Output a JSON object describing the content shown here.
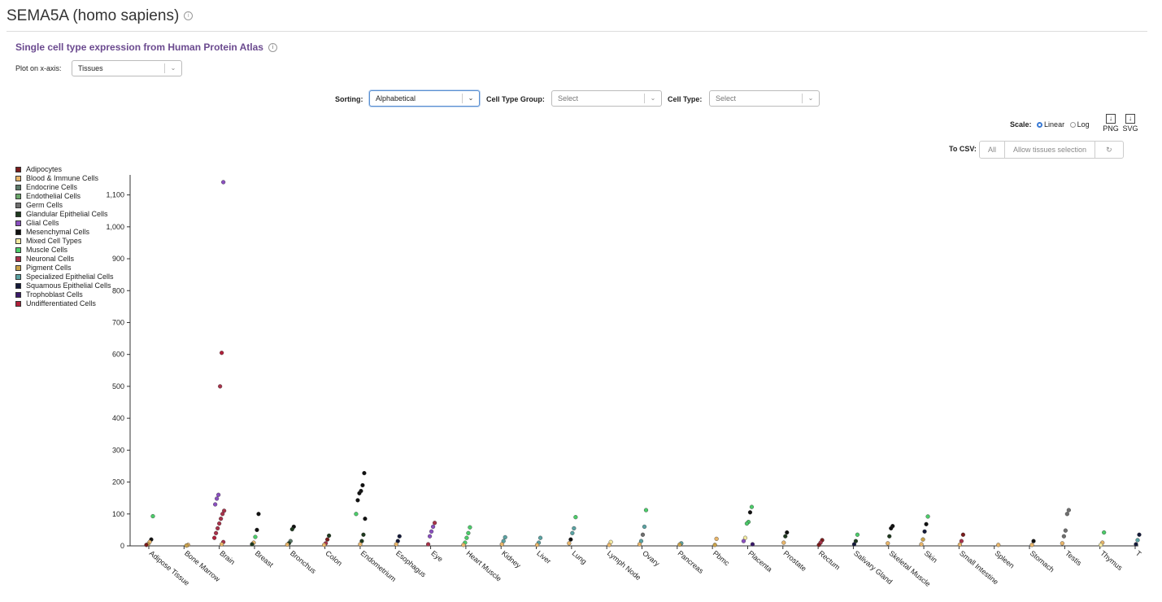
{
  "page": {
    "title": "SEMA5A (homo sapiens)",
    "section_title": "Single cell type expression from Human Protein Atlas"
  },
  "controls": {
    "xaxis_label": "Plot on x-axis:",
    "xaxis_value": "Tissues",
    "sorting_label": "Sorting:",
    "sorting_value": "Alphabetical",
    "cell_type_group_label": "Cell Type Group:",
    "cell_type_group_placeholder": "Select",
    "cell_type_label": "Cell Type:",
    "cell_type_placeholder": "Select",
    "scale_label": "Scale:",
    "scale_linear": "Linear",
    "scale_log": "Log",
    "scale_selected": "Linear",
    "png_label": "PNG",
    "svg_label": "SVG",
    "csv_label": "To CSV:",
    "csv_all": "All",
    "csv_allow": "Allow tissues selection",
    "refresh_icon": "refresh-icon"
  },
  "chart_data": {
    "type": "scatter",
    "title": "",
    "xlabel": "",
    "ylabel": "",
    "ylim": [
      0,
      1150
    ],
    "yticks": [
      0,
      100,
      200,
      300,
      400,
      500,
      600,
      700,
      800,
      900,
      1000,
      1100
    ],
    "ytick_labels": [
      "0",
      "100",
      "200",
      "300",
      "400",
      "500",
      "600",
      "700",
      "800",
      "900",
      "1,000",
      "1,100"
    ],
    "legend_position": "left",
    "categories": [
      "Adipose Tissue",
      "Bone Marrow",
      "Brain",
      "Breast",
      "Bronchus",
      "Colon",
      "Endometrium",
      "Esophagus",
      "Eye",
      "Heart Muscle",
      "Kidney",
      "Liver",
      "Lung",
      "Lymph Node",
      "Ovary",
      "Pancreas",
      "Pbmc",
      "Placenta",
      "Prostate",
      "Rectum",
      "Salivary Gland",
      "Skeletal Muscle",
      "Skin",
      "Small Intestine",
      "Spleen",
      "Stomach",
      "Testis",
      "Thymus",
      "T"
    ],
    "legend": [
      {
        "name": "Adipocytes",
        "color": "#7a1c1c"
      },
      {
        "name": "Blood & Immune Cells",
        "color": "#e8b56a"
      },
      {
        "name": "Endocrine Cells",
        "color": "#5c7a6a"
      },
      {
        "name": "Endothelial Cells",
        "color": "#6aa86a"
      },
      {
        "name": "Germ Cells",
        "color": "#6f6f6f"
      },
      {
        "name": "Glandular Epithelial Cells",
        "color": "#1f3a1f"
      },
      {
        "name": "Glial Cells",
        "color": "#8a4fbf"
      },
      {
        "name": "Mesenchymal Cells",
        "color": "#111111"
      },
      {
        "name": "Mixed Cell Types",
        "color": "#f3e9a0"
      },
      {
        "name": "Muscle Cells",
        "color": "#4ccc6a"
      },
      {
        "name": "Neuronal Cells",
        "color": "#a8324a"
      },
      {
        "name": "Pigment Cells",
        "color": "#c9a24a"
      },
      {
        "name": "Specialized Epithelial Cells",
        "color": "#5aa3a3"
      },
      {
        "name": "Squamous Epithelial Cells",
        "color": "#141a3a"
      },
      {
        "name": "Trophoblast Cells",
        "color": "#3a1a6a"
      },
      {
        "name": "Undifferentiated Cells",
        "color": "#b0203a"
      }
    ],
    "points": [
      {
        "x": "Adipose Tissue",
        "y": 93,
        "group": "Muscle Cells"
      },
      {
        "x": "Adipose Tissue",
        "y": 20,
        "group": "Mesenchymal Cells"
      },
      {
        "x": "Adipose Tissue",
        "y": 12,
        "group": "Blood & Immune Cells"
      },
      {
        "x": "Adipose Tissue",
        "y": 5,
        "group": "Pigment Cells"
      },
      {
        "x": "Adipose Tissue",
        "y": 3,
        "group": "Adipocytes"
      },
      {
        "x": "Bone Marrow",
        "y": 3,
        "group": "Blood & Immune Cells"
      },
      {
        "x": "Bone Marrow",
        "y": 1,
        "group": "Pigment Cells"
      },
      {
        "x": "Brain",
        "y": 1140,
        "group": "Glial Cells"
      },
      {
        "x": "Brain",
        "y": 605,
        "group": "Undifferentiated Cells"
      },
      {
        "x": "Brain",
        "y": 500,
        "group": "Neuronal Cells"
      },
      {
        "x": "Brain",
        "y": 160,
        "group": "Glial Cells"
      },
      {
        "x": "Brain",
        "y": 148,
        "group": "Glial Cells"
      },
      {
        "x": "Brain",
        "y": 130,
        "group": "Glial Cells"
      },
      {
        "x": "Brain",
        "y": 110,
        "group": "Neuronal Cells"
      },
      {
        "x": "Brain",
        "y": 100,
        "group": "Neuronal Cells"
      },
      {
        "x": "Brain",
        "y": 85,
        "group": "Neuronal Cells"
      },
      {
        "x": "Brain",
        "y": 70,
        "group": "Neuronal Cells"
      },
      {
        "x": "Brain",
        "y": 55,
        "group": "Neuronal Cells"
      },
      {
        "x": "Brain",
        "y": 40,
        "group": "Neuronal Cells"
      },
      {
        "x": "Brain",
        "y": 25,
        "group": "Undifferentiated Cells"
      },
      {
        "x": "Brain",
        "y": 12,
        "group": "Neuronal Cells"
      },
      {
        "x": "Brain",
        "y": 5,
        "group": "Blood & Immune Cells"
      },
      {
        "x": "Breast",
        "y": 100,
        "group": "Mesenchymal Cells"
      },
      {
        "x": "Breast",
        "y": 50,
        "group": "Mesenchymal Cells"
      },
      {
        "x": "Breast",
        "y": 28,
        "group": "Muscle Cells"
      },
      {
        "x": "Breast",
        "y": 10,
        "group": "Blood & Immune Cells"
      },
      {
        "x": "Breast",
        "y": 5,
        "group": "Glandular Epithelial Cells"
      },
      {
        "x": "Bronchus",
        "y": 60,
        "group": "Mesenchymal Cells"
      },
      {
        "x": "Bronchus",
        "y": 52,
        "group": "Glandular Epithelial Cells"
      },
      {
        "x": "Bronchus",
        "y": 15,
        "group": "Endocrine Cells"
      },
      {
        "x": "Bronchus",
        "y": 8,
        "group": "Glandular Epithelial Cells"
      },
      {
        "x": "Bronchus",
        "y": 4,
        "group": "Blood & Immune Cells"
      },
      {
        "x": "Colon",
        "y": 32,
        "group": "Glandular Epithelial Cells"
      },
      {
        "x": "Colon",
        "y": 20,
        "group": "Adipocytes"
      },
      {
        "x": "Colon",
        "y": 8,
        "group": "Neuronal Cells"
      },
      {
        "x": "Colon",
        "y": 3,
        "group": "Blood & Immune Cells"
      },
      {
        "x": "Endometrium",
        "y": 228,
        "group": "Mesenchymal Cells"
      },
      {
        "x": "Endometrium",
        "y": 190,
        "group": "Mesenchymal Cells"
      },
      {
        "x": "Endometrium",
        "y": 172,
        "group": "Mesenchymal Cells"
      },
      {
        "x": "Endometrium",
        "y": 165,
        "group": "Mesenchymal Cells"
      },
      {
        "x": "Endometrium",
        "y": 143,
        "group": "Mesenchymal Cells"
      },
      {
        "x": "Endometrium",
        "y": 100,
        "group": "Muscle Cells"
      },
      {
        "x": "Endometrium",
        "y": 85,
        "group": "Mesenchymal Cells"
      },
      {
        "x": "Endometrium",
        "y": 35,
        "group": "Glandular Epithelial Cells"
      },
      {
        "x": "Endometrium",
        "y": 15,
        "group": "Glandular Epithelial Cells"
      },
      {
        "x": "Endometrium",
        "y": 5,
        "group": "Blood & Immune Cells"
      },
      {
        "x": "Esophagus",
        "y": 30,
        "group": "Squamous Epithelial Cells"
      },
      {
        "x": "Esophagus",
        "y": 15,
        "group": "Squamous Epithelial Cells"
      },
      {
        "x": "Esophagus",
        "y": 5,
        "group": "Blood & Immune Cells"
      },
      {
        "x": "Eye",
        "y": 72,
        "group": "Neuronal Cells"
      },
      {
        "x": "Eye",
        "y": 60,
        "group": "Glial Cells"
      },
      {
        "x": "Eye",
        "y": 45,
        "group": "Glial Cells"
      },
      {
        "x": "Eye",
        "y": 30,
        "group": "Glial Cells"
      },
      {
        "x": "Eye",
        "y": 5,
        "group": "Neuronal Cells"
      },
      {
        "x": "Heart Muscle",
        "y": 58,
        "group": "Muscle Cells"
      },
      {
        "x": "Heart Muscle",
        "y": 40,
        "group": "Muscle Cells"
      },
      {
        "x": "Heart Muscle",
        "y": 25,
        "group": "Muscle Cells"
      },
      {
        "x": "Heart Muscle",
        "y": 10,
        "group": "Muscle Cells"
      },
      {
        "x": "Heart Muscle",
        "y": 3,
        "group": "Blood & Immune Cells"
      },
      {
        "x": "Kidney",
        "y": 27,
        "group": "Specialized Epithelial Cells"
      },
      {
        "x": "Kidney",
        "y": 15,
        "group": "Specialized Epithelial Cells"
      },
      {
        "x": "Kidney",
        "y": 5,
        "group": "Blood & Immune Cells"
      },
      {
        "x": "Liver",
        "y": 25,
        "group": "Specialized Epithelial Cells"
      },
      {
        "x": "Liver",
        "y": 10,
        "group": "Specialized Epithelial Cells"
      },
      {
        "x": "Liver",
        "y": 3,
        "group": "Blood & Immune Cells"
      },
      {
        "x": "Lung",
        "y": 90,
        "group": "Muscle Cells"
      },
      {
        "x": "Lung",
        "y": 55,
        "group": "Specialized Epithelial Cells"
      },
      {
        "x": "Lung",
        "y": 40,
        "group": "Specialized Epithelial Cells"
      },
      {
        "x": "Lung",
        "y": 20,
        "group": "Mesenchymal Cells"
      },
      {
        "x": "Lung",
        "y": 8,
        "group": "Blood & Immune Cells"
      },
      {
        "x": "Lymph Node",
        "y": 12,
        "group": "Mixed Cell Types"
      },
      {
        "x": "Lymph Node",
        "y": 3,
        "group": "Blood & Immune Cells"
      },
      {
        "x": "Ovary",
        "y": 112,
        "group": "Muscle Cells"
      },
      {
        "x": "Ovary",
        "y": 60,
        "group": "Specialized Epithelial Cells"
      },
      {
        "x": "Ovary",
        "y": 35,
        "group": "Germ Cells"
      },
      {
        "x": "Ovary",
        "y": 15,
        "group": "Specialized Epithelial Cells"
      },
      {
        "x": "Ovary",
        "y": 5,
        "group": "Blood & Immune Cells"
      },
      {
        "x": "Pancreas",
        "y": 8,
        "group": "Specialized Epithelial Cells"
      },
      {
        "x": "Pancreas",
        "y": 4,
        "group": "Pigment Cells"
      },
      {
        "x": "Pbmc",
        "y": 22,
        "group": "Blood & Immune Cells"
      },
      {
        "x": "Pbmc",
        "y": 3,
        "group": "Pigment Cells"
      },
      {
        "x": "Placenta",
        "y": 122,
        "group": "Muscle Cells"
      },
      {
        "x": "Placenta",
        "y": 105,
        "group": "Mesenchymal Cells"
      },
      {
        "x": "Placenta",
        "y": 75,
        "group": "Muscle Cells"
      },
      {
        "x": "Placenta",
        "y": 70,
        "group": "Muscle Cells"
      },
      {
        "x": "Placenta",
        "y": 25,
        "group": "Mixed Cell Types"
      },
      {
        "x": "Placenta",
        "y": 15,
        "group": "Glial Cells"
      },
      {
        "x": "Placenta",
        "y": 5,
        "group": "Trophoblast Cells"
      },
      {
        "x": "Prostate",
        "y": 42,
        "group": "Mesenchymal Cells"
      },
      {
        "x": "Prostate",
        "y": 30,
        "group": "Glandular Epithelial Cells"
      },
      {
        "x": "Prostate",
        "y": 10,
        "group": "Blood & Immune Cells"
      },
      {
        "x": "Rectum",
        "y": 18,
        "group": "Adipocytes"
      },
      {
        "x": "Rectum",
        "y": 10,
        "group": "Neuronal Cells"
      },
      {
        "x": "Rectum",
        "y": 3,
        "group": "Adipocytes"
      },
      {
        "x": "Salivary Gland",
        "y": 35,
        "group": "Muscle Cells"
      },
      {
        "x": "Salivary Gland",
        "y": 15,
        "group": "Glandular Epithelial Cells"
      },
      {
        "x": "Salivary Gland",
        "y": 5,
        "group": "Squamous Epithelial Cells"
      },
      {
        "x": "Skeletal Muscle",
        "y": 62,
        "group": "Mesenchymal Cells"
      },
      {
        "x": "Skeletal Muscle",
        "y": 55,
        "group": "Mesenchymal Cells"
      },
      {
        "x": "Skeletal Muscle",
        "y": 30,
        "group": "Glandular Epithelial Cells"
      },
      {
        "x": "Skeletal Muscle",
        "y": 8,
        "group": "Blood & Immune Cells"
      },
      {
        "x": "Skin",
        "y": 92,
        "group": "Muscle Cells"
      },
      {
        "x": "Skin",
        "y": 68,
        "group": "Mesenchymal Cells"
      },
      {
        "x": "Skin",
        "y": 45,
        "group": "Squamous Epithelial Cells"
      },
      {
        "x": "Skin",
        "y": 20,
        "group": "Pigment Cells"
      },
      {
        "x": "Skin",
        "y": 5,
        "group": "Blood & Immune Cells"
      },
      {
        "x": "Small Intestine",
        "y": 35,
        "group": "Adipocytes"
      },
      {
        "x": "Small Intestine",
        "y": 15,
        "group": "Neuronal Cells"
      },
      {
        "x": "Small Intestine",
        "y": 4,
        "group": "Blood & Immune Cells"
      },
      {
        "x": "Spleen",
        "y": 3,
        "group": "Blood & Immune Cells"
      },
      {
        "x": "Stomach",
        "y": 15,
        "group": "Mesenchymal Cells"
      },
      {
        "x": "Stomach",
        "y": 3,
        "group": "Blood & Immune Cells"
      },
      {
        "x": "Testis",
        "y": 112,
        "group": "Germ Cells"
      },
      {
        "x": "Testis",
        "y": 100,
        "group": "Germ Cells"
      },
      {
        "x": "Testis",
        "y": 48,
        "group": "Germ Cells"
      },
      {
        "x": "Testis",
        "y": 30,
        "group": "Germ Cells"
      },
      {
        "x": "Testis",
        "y": 8,
        "group": "Blood & Immune Cells"
      },
      {
        "x": "Thymus",
        "y": 42,
        "group": "Muscle Cells"
      },
      {
        "x": "Thymus",
        "y": 10,
        "group": "Blood & Immune Cells"
      },
      {
        "x": "Thymus",
        "y": 3,
        "group": "Mixed Cell Types"
      },
      {
        "x": "T",
        "y": 35,
        "group": "Squamous Epithelial Cells"
      },
      {
        "x": "T",
        "y": 18,
        "group": "Specialized Epithelial Cells"
      },
      {
        "x": "T",
        "y": 5,
        "group": "Squamous Epithelial Cells"
      }
    ]
  }
}
